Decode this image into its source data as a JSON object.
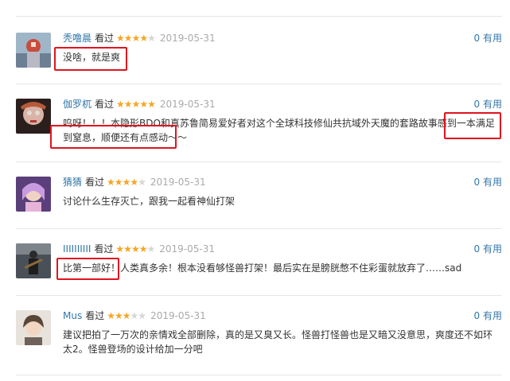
{
  "comments": [
    {
      "user": "秃噜晨",
      "watched": "看过",
      "rating": 4,
      "date": "2019-05-31",
      "votes": "0",
      "useful": "有用",
      "text": "没啥，就是爽"
    },
    {
      "user": "伽罗杌",
      "watched": "看过",
      "rating": 5,
      "date": "2019-05-31",
      "votes": "0",
      "useful": "有用",
      "text": "呜呀！！！本隐形BDO和真苏鲁简易爱好者对这个全球科技修仙共抗域外天魔的套路故事感到一本满足到窒息，顺便还有点感动～～"
    },
    {
      "user": "猜猜",
      "watched": "看过",
      "rating": 4,
      "date": "2019-05-31",
      "votes": "0",
      "useful": "有用",
      "text": "讨论什么生存灭亡，跟我一起看神仙打架"
    },
    {
      "user": "IIIIIIIIII",
      "watched": "看过",
      "rating": 4,
      "date": "2019-05-31",
      "votes": "0",
      "useful": "有用",
      "text": "比第一部好！人类真多余！根本没看够怪兽打架！最后实在是膀胱憋不住彩蛋就放弃了……sad"
    },
    {
      "user": "Mus",
      "watched": "看过",
      "rating": 3,
      "date": "2019-05-31",
      "votes": "0",
      "useful": "有用",
      "text": "建议把拍了一万次的亲情戏全部删除，真的是又臭又长。怪兽打怪兽也是又暗又没意思，爽度还不如环太2。怪兽登场的设计给加一分吧"
    }
  ],
  "colors": {
    "link": "#3377aa",
    "star": "#f5a623",
    "highlight": "#e0141e"
  }
}
